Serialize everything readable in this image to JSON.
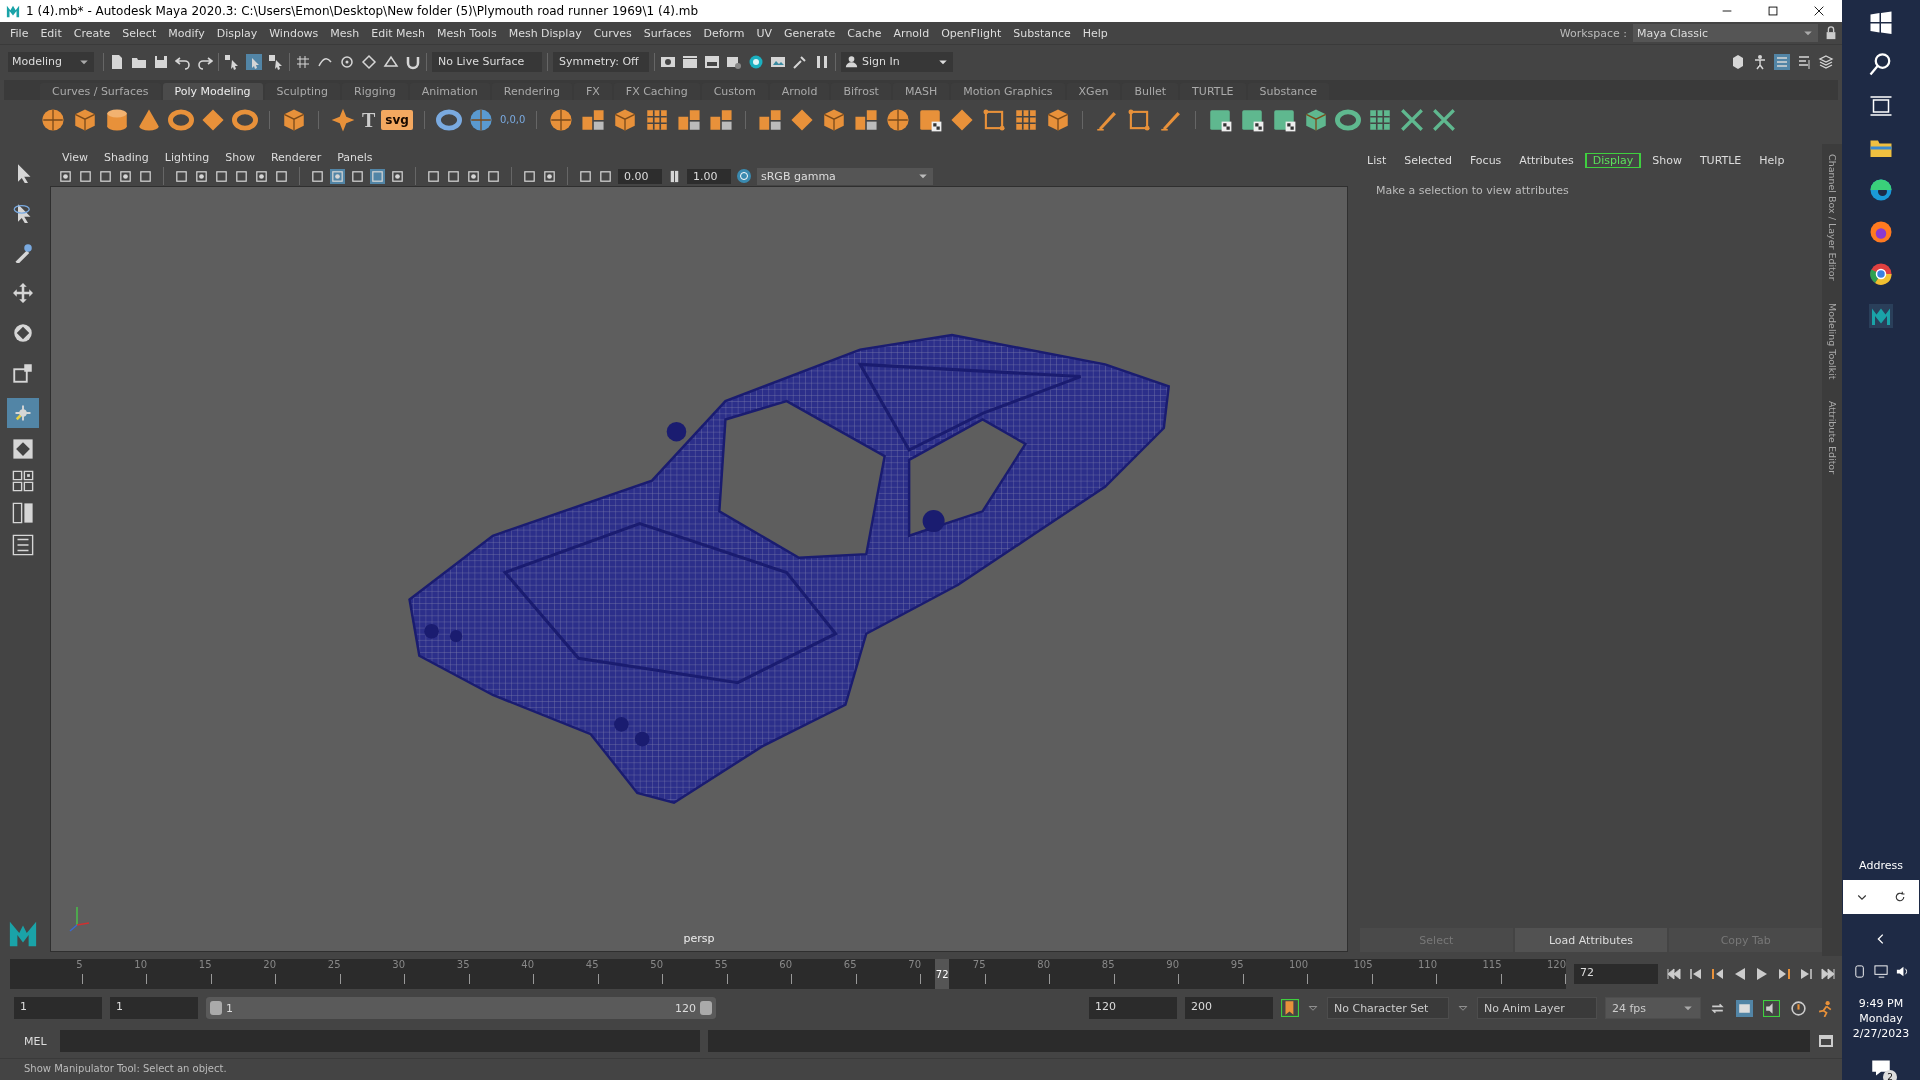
{
  "window": {
    "title": "1 (4).mb* - Autodesk Maya 2020.3: C:\\Users\\Emon\\Desktop\\New folder (5)\\Plymouth road runner 1969\\1 (4).mb"
  },
  "menu": [
    "File",
    "Edit",
    "Create",
    "Select",
    "Modify",
    "Display",
    "Windows",
    "Mesh",
    "Edit Mesh",
    "Mesh Tools",
    "Mesh Display",
    "Curves",
    "Surfaces",
    "Deform",
    "UV",
    "Generate",
    "Cache",
    "Arnold",
    "OpenFlight",
    "Substance",
    "Help"
  ],
  "workspace": {
    "label": "Workspace :",
    "value": "Maya Classic"
  },
  "status_line": {
    "mode": "Modeling",
    "live_surface": "No Live Surface",
    "symmetry": "Symmetry: Off",
    "sign_in": "Sign In"
  },
  "shelf": {
    "tabs": [
      {
        "label": "Curves / Surfaces",
        "selected": false
      },
      {
        "label": "Poly Modeling",
        "selected": true
      },
      {
        "label": "Sculpting",
        "selected": false
      },
      {
        "label": "Rigging",
        "selected": false
      },
      {
        "label": "Animation",
        "selected": false
      },
      {
        "label": "Rendering",
        "selected": false
      },
      {
        "label": "FX",
        "selected": false
      },
      {
        "label": "FX Caching",
        "selected": false
      },
      {
        "label": "Custom",
        "selected": false
      },
      {
        "label": "Arnold",
        "selected": false
      },
      {
        "label": "Bifrost",
        "selected": false
      },
      {
        "label": "MASH",
        "selected": false
      },
      {
        "label": "Motion Graphics",
        "selected": false
      },
      {
        "label": "XGen",
        "selected": false
      },
      {
        "label": "Bullet",
        "selected": false
      },
      {
        "label": "TURTLE",
        "selected": false
      },
      {
        "label": "Substance",
        "selected": false
      }
    ],
    "icon_texts": [
      "T",
      "svg",
      "0,0,0"
    ]
  },
  "toolbox": [
    {
      "selected": false
    },
    {
      "selected": false
    },
    {
      "selected": false
    },
    {
      "selected": false
    },
    {
      "selected": false
    },
    {
      "selected": false
    },
    {
      "selected": true
    }
  ],
  "viewport": {
    "menu": [
      "View",
      "Shading",
      "Lighting",
      "Show",
      "Renderer",
      "Panels"
    ],
    "exposure": "0.00",
    "gamma": "1.00",
    "color_space": "sRGB gamma",
    "camera": "persp"
  },
  "attribute_editor": {
    "menu": [
      {
        "label": "List",
        "selected": false
      },
      {
        "label": "Selected",
        "selected": false
      },
      {
        "label": "Focus",
        "selected": false
      },
      {
        "label": "Attributes",
        "selected": false
      },
      {
        "label": "Display",
        "selected": true
      },
      {
        "label": "Show",
        "selected": false
      },
      {
        "label": "TURTLE",
        "selected": false
      },
      {
        "label": "Help",
        "selected": false
      }
    ],
    "message": "Make a selection to view attributes",
    "buttons": [
      {
        "label": "Select",
        "disabled": true
      },
      {
        "label": "Load Attributes",
        "disabled": false
      },
      {
        "label": "Copy Tab",
        "disabled": true
      }
    ]
  },
  "side_tabs": [
    "Channel Box / Layer Editor",
    "Modeling Toolkit",
    "Attribute Editor"
  ],
  "timeline": {
    "ticks": [
      "5",
      "10",
      "15",
      "20",
      "25",
      "30",
      "35",
      "40",
      "45",
      "50",
      "55",
      "60",
      "65",
      "70",
      "75",
      "80",
      "85",
      "90",
      "95",
      "100",
      "105",
      "110",
      "115",
      "120"
    ],
    "playhead": {
      "label": "72",
      "level": 0.597
    },
    "current_frame": "72"
  },
  "range": {
    "start": "1",
    "playback_start": "1",
    "slider": {
      "start_label": "1",
      "end_label": "120",
      "level": 1
    },
    "playback_end": "120",
    "end": "200"
  },
  "character_set": "No Character Set",
  "anim_layer": "No Anim Layer",
  "fps": "24 fps",
  "command_line": {
    "label": "MEL"
  },
  "help_line": "Show Manipulator Tool: Select an object.",
  "taskbar": {
    "address": "Address",
    "time": "9:49 PM",
    "day": "Monday",
    "date": "2/27/2023",
    "notifications": "2"
  }
}
